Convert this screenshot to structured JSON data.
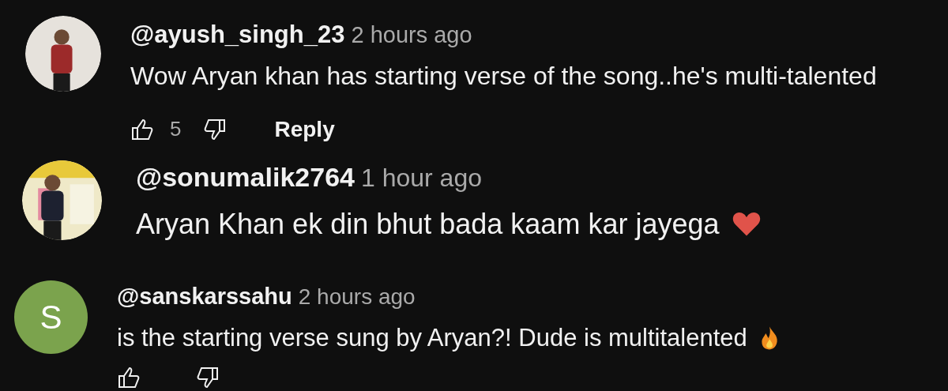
{
  "comments": [
    {
      "author": "@ayush_singh_23",
      "time": "2 hours ago",
      "text": "Wow Aryan khan has starting verse of the song..he's multi-talented",
      "actions": {
        "kind": "full",
        "likes": "5",
        "reply": "Reply"
      }
    },
    {
      "author": "@sonumalik2764",
      "time": "1 hour ago",
      "text": "Aryan Khan ek din bhut bada kaam kar jayega",
      "reaction_icon": {
        "kind": "heart"
      }
    },
    {
      "avatar": {
        "kind": "letter",
        "letter": "S"
      },
      "author": "@sanskarssahu",
      "time": "2 hours ago",
      "text": "is the starting verse sung by Aryan?! Dude is multitalented",
      "reaction_icon": {
        "kind": "fire"
      },
      "actions": {
        "kind": "icons_only"
      }
    }
  ]
}
